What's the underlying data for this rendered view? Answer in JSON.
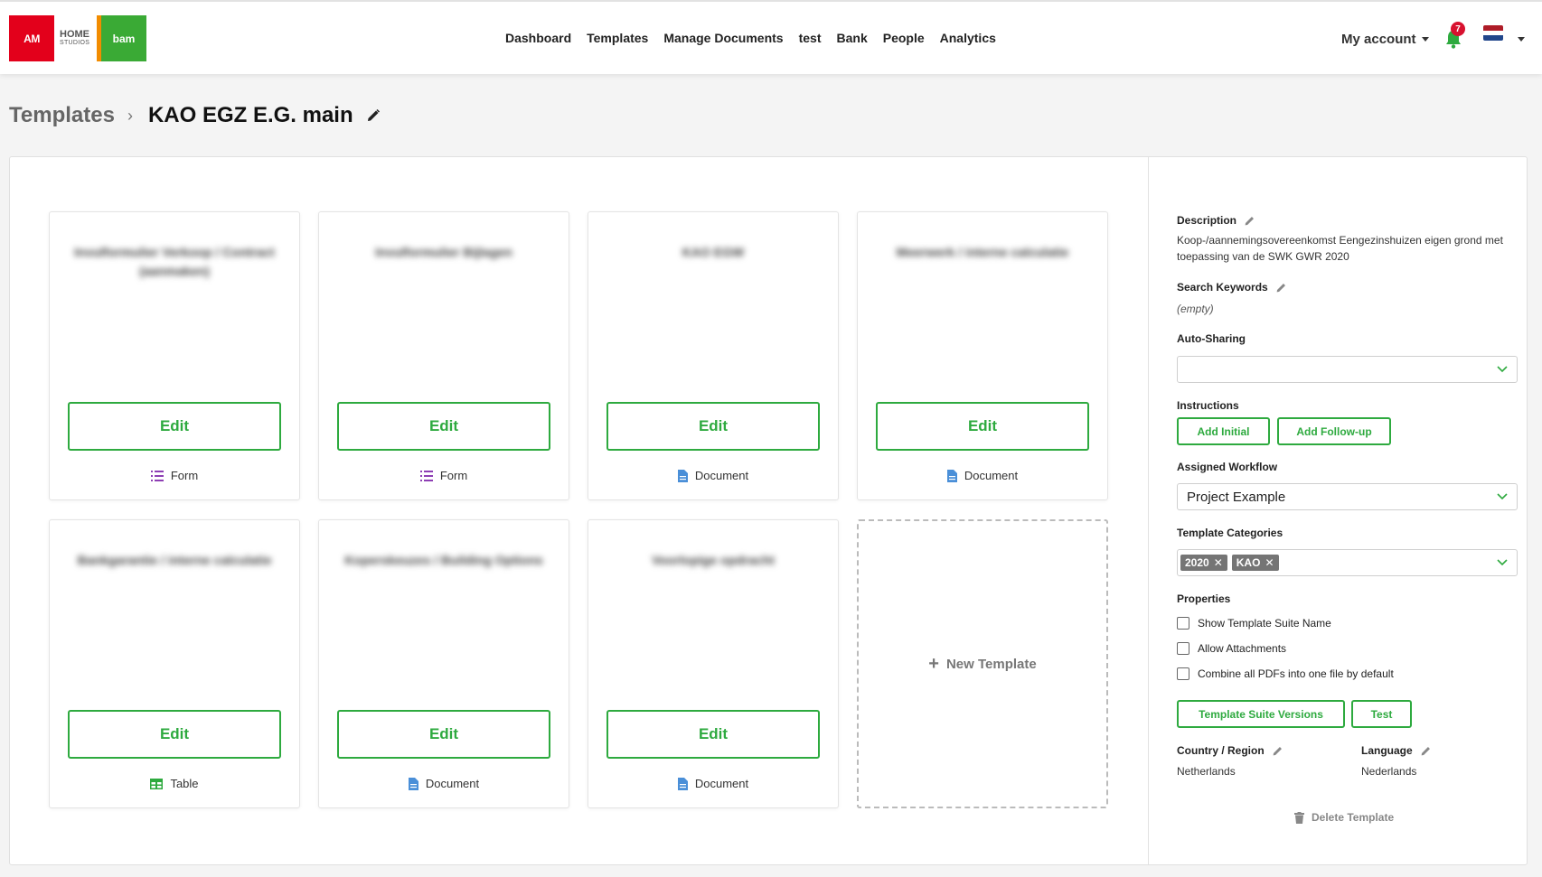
{
  "brand": {
    "logo_am": "AM",
    "logo_home": "HOME",
    "logo_studios": "STUDIOS",
    "logo_bam": "bam"
  },
  "nav": {
    "items": [
      "Dashboard",
      "Templates",
      "Manage Documents",
      "test",
      "Bank",
      "People",
      "Analytics"
    ]
  },
  "account": {
    "label": "My account",
    "notification_count": "7",
    "flag_colors": [
      "#ae1c28",
      "#ffffff",
      "#21468b"
    ]
  },
  "breadcrumb": {
    "root": "Templates",
    "current": "KAO EGZ E.G. main"
  },
  "cards": [
    {
      "title": "Invulformulier Verkoop / Contract (aanmaken)",
      "edit_label": "Edit",
      "type": "Form",
      "icon": "list-icon"
    },
    {
      "title": "Invulformulier Bijlagen",
      "edit_label": "Edit",
      "type": "Form",
      "icon": "list-icon"
    },
    {
      "title": "KAO EGW",
      "edit_label": "Edit",
      "type": "Document",
      "icon": "document-icon"
    },
    {
      "title": "Meerwerk / interne calculatie",
      "edit_label": "Edit",
      "type": "Document",
      "icon": "document-icon"
    },
    {
      "title": "Bankgarantie / interne calculatie",
      "edit_label": "Edit",
      "type": "Table",
      "icon": "table-icon"
    },
    {
      "title": "Koperskeuzes / Building Options",
      "edit_label": "Edit",
      "type": "Document",
      "icon": "document-icon"
    },
    {
      "title": "Voorlopige opdracht",
      "edit_label": "Edit",
      "type": "Document",
      "icon": "document-icon"
    }
  ],
  "new_template_label": "New Template",
  "sidebar": {
    "description_label": "Description",
    "description_text": "Koop-/aannemingsovereenkomst Eengezinshuizen eigen grond met toepassing van de SWK GWR 2020",
    "keywords_label": "Search Keywords",
    "keywords_value": "(empty)",
    "autosharing_label": "Auto-Sharing",
    "autosharing_value": "",
    "instructions_label": "Instructions",
    "add_initial": "Add Initial",
    "add_followup": "Add Follow-up",
    "workflow_label": "Assigned Workflow",
    "workflow_value": "Project Example",
    "categories_label": "Template Categories",
    "categories": [
      "2020",
      "KAO"
    ],
    "properties_label": "Properties",
    "properties": [
      "Show Template Suite Name",
      "Allow Attachments",
      "Combine all PDFs into one file by default"
    ],
    "suite_versions": "Template Suite Versions",
    "test": "Test",
    "country_label": "Country / Region",
    "country_value": "Netherlands",
    "language_label": "Language",
    "language_value": "Nederlands",
    "delete_label": "Delete Template"
  },
  "colors": {
    "accent_green": "#2eaa3f",
    "form_purple": "#8e3fb4",
    "document_blue": "#4a8fd8",
    "table_green": "#2eaa3f"
  }
}
